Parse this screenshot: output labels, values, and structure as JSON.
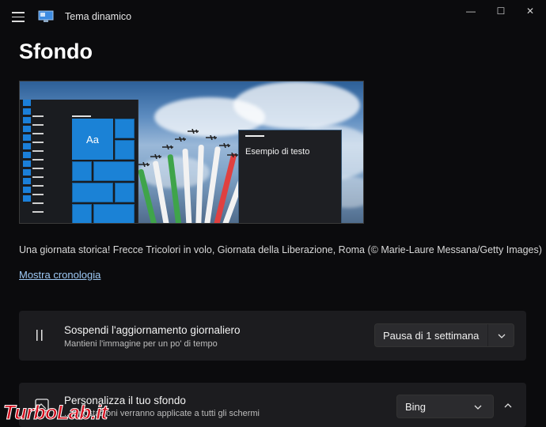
{
  "window": {
    "title": "Tema dinamico",
    "minimize_glyph": "—",
    "maximize_glyph": "☐",
    "close_glyph": "✕"
  },
  "page": {
    "title": "Sfondo"
  },
  "preview": {
    "start_tile_text": "Aa",
    "sample_window_text": "Esempio di testo"
  },
  "caption": "Una giornata storica! Frecce Tricolori in volo, Giornata della Liberazione, Roma (© Marie-Laure Messana/Getty Images)",
  "history_link": "Mostra cronologia",
  "pause_card": {
    "title": "Sospendi l'aggiornamento giornaliero",
    "subtitle": "Mantieni l'immagine per un po' di tempo",
    "dropdown_value": "Pausa di 1 settimana"
  },
  "personalize_card": {
    "title": "Personalizza il tuo sfondo",
    "subtitle": "...mpostazioni verranno applicate a tutti gli schermi",
    "dropdown_value": "Bing"
  },
  "watermark": "TurboLab.it",
  "colors": {
    "accent": "#1b82d6",
    "link": "#9ec9f5",
    "card": "#1c1c1f",
    "background": "#0b0b0d"
  },
  "icons": [
    "menu-icon",
    "app-icon",
    "pause-icon",
    "image-icon",
    "chevron-down-icon",
    "chevron-up-icon"
  ]
}
